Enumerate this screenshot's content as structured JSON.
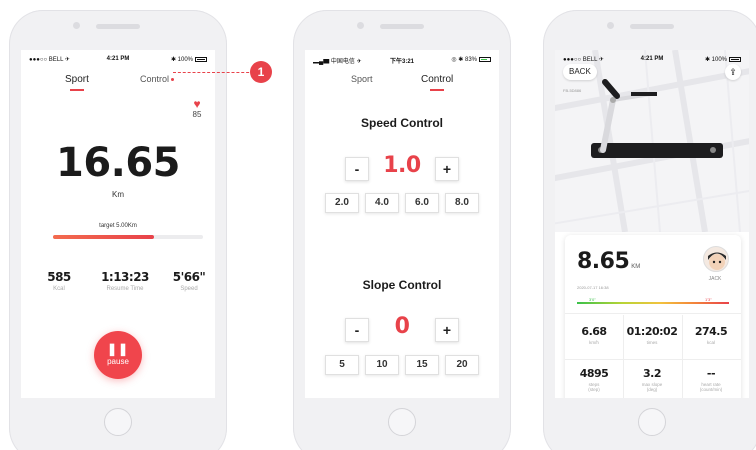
{
  "screen1": {
    "status": {
      "carrier": "●●●○○ BELL ✈",
      "time": "4:21 PM",
      "battery": "✱ 100%"
    },
    "tabs": [
      "Sport",
      "Control"
    ],
    "callout_number": "1",
    "heart_rate": "85",
    "distance": "16.65",
    "distance_unit": "Km",
    "target_label": "target 5.00Km",
    "progress_fraction": 0.67,
    "stats": [
      {
        "value": "585",
        "label": "Kcal"
      },
      {
        "value": "1:13:23",
        "label": "Resume Time"
      },
      {
        "value": "5'66\"",
        "label": "Speed"
      }
    ],
    "pause_label": "pause"
  },
  "screen2": {
    "status": {
      "carrier": "▂▄▆ 中国电信 ✈",
      "time": "下午3:21",
      "battery": "◎ ✱ 83%"
    },
    "tabs": [
      "Sport",
      "Control"
    ],
    "speed": {
      "title": "Speed Control",
      "value": "1.0",
      "minus": "-",
      "plus": "+",
      "presets": [
        "2.0",
        "4.0",
        "6.0",
        "8.0"
      ]
    },
    "slope": {
      "title": "Slope Control",
      "value": "0",
      "minus": "-",
      "plus": "+",
      "presets": [
        "5",
        "10",
        "15",
        "20"
      ]
    }
  },
  "screen3": {
    "status": {
      "carrier": "●●●○○ BELL ✈",
      "time": "4:21 PM",
      "battery": "✱ 100%"
    },
    "back_label": "BACK",
    "device_id": "FB-5D886",
    "distance": "8.65",
    "distance_unit": "KM",
    "date": "2020-07-17 16:38",
    "user_name": "JACK",
    "gauge_left": "3'0\"",
    "gauge_right": "1'3\"",
    "stats": [
      {
        "value": "6.68",
        "label": "km/h"
      },
      {
        "value": "01:20:02",
        "label": "times"
      },
      {
        "value": "274.5",
        "label": "kcal"
      },
      {
        "value": "4895",
        "label": "steps\n(step)"
      },
      {
        "value": "3.2",
        "label": "max slope\n(deg)"
      },
      {
        "value": "--",
        "label": "heart rate\n(count/min)"
      }
    ]
  },
  "colors": {
    "accent": "#e8424a",
    "green": "#3bc14a"
  }
}
